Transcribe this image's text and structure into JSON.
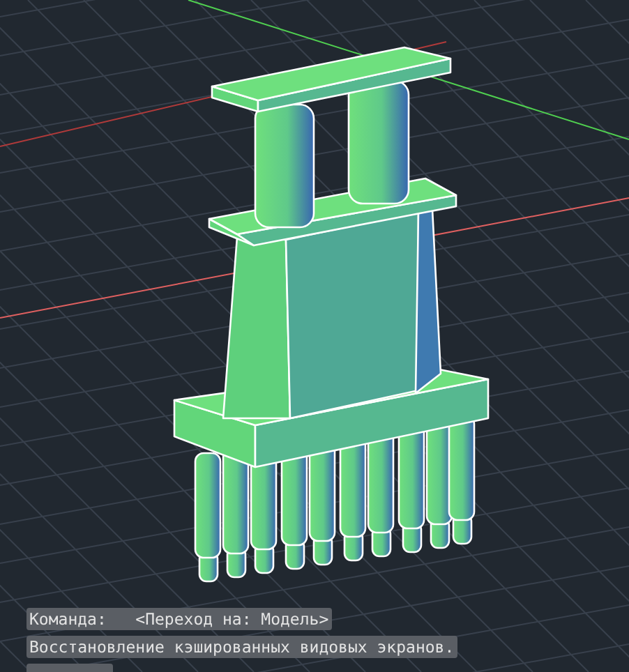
{
  "command_lines": [
    {
      "text": "Команда:   <Переход на: Модель>"
    },
    {
      "text": "Восстановление кэшированных видовых экранов."
    }
  ]
}
